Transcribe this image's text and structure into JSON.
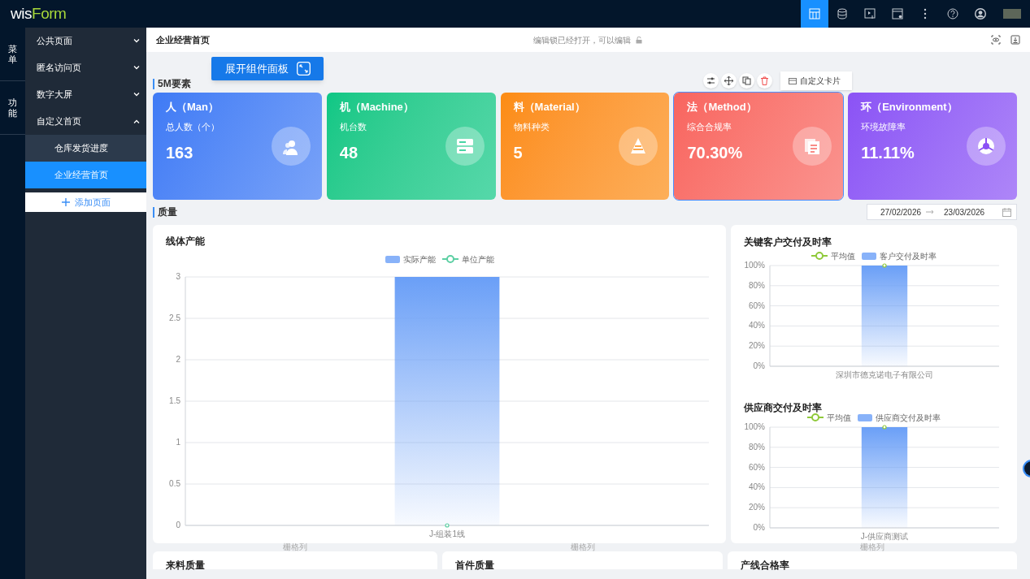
{
  "brand": {
    "part_a": "wis",
    "part_b": "Form"
  },
  "topbar_icons": [
    {
      "kind": "layout",
      "selected": true
    },
    {
      "kind": "database",
      "selected": false
    },
    {
      "kind": "screen",
      "selected": false
    },
    {
      "kind": "window",
      "selected": false
    },
    {
      "kind": "more",
      "selected": false
    },
    {
      "kind": "help",
      "selected": false
    },
    {
      "kind": "user",
      "selected": false
    }
  ],
  "rail": [
    "菜单",
    "功能"
  ],
  "nav": [
    {
      "label": "公共页面",
      "expanded": false
    },
    {
      "label": "匿名访问页",
      "expanded": false
    },
    {
      "label": "数字大屏",
      "expanded": false
    },
    {
      "label": "自定义首页",
      "expanded": true,
      "children": [
        {
          "label": "仓库发货进度",
          "selected": false
        },
        {
          "label": "企业经营首页",
          "selected": true
        }
      ]
    }
  ],
  "add_page": "添加页面",
  "header": {
    "title": "企业经营首页",
    "lock_status": "编辑锁已经打开，可以编辑"
  },
  "expand_button": "展开组件面板",
  "section_5m": "5M要素",
  "card_toolbar": {
    "label": "自定义卡片"
  },
  "cards": [
    {
      "title": "人（Man）",
      "label": "总人数（个）",
      "value": "163",
      "kind": "people",
      "color": "#3f7af5",
      "selected": false
    },
    {
      "title": "机（Machine）",
      "label": "机台数",
      "value": "48",
      "kind": "server",
      "color": "#0dc785",
      "selected": false
    },
    {
      "title": "料（Material）",
      "label": "物料种类",
      "value": "5",
      "kind": "material",
      "color": "#fc8c12",
      "selected": false
    },
    {
      "title": "法（Method）",
      "label": "综合合规率",
      "value": "70.30%",
      "kind": "document",
      "color": "#f8655f",
      "selected": true
    },
    {
      "title": "环（Environment）",
      "label": "环境故障率",
      "value": "11.11%",
      "kind": "pie",
      "color": "#8b52f5",
      "selected": false
    }
  ],
  "section_quality": "质量",
  "date_range": {
    "start": "27/02/2026",
    "end": "23/03/2026"
  },
  "charts": [
    {
      "chart_data": {
        "type": "bar",
        "grid": true,
        "title": "线体产能",
        "categories": [
          "J-组装1线"
        ],
        "ylim": [
          0,
          3
        ],
        "yticks": [
          0,
          0.5,
          1,
          1.5,
          2,
          2.5,
          3
        ],
        "series": [
          {
            "name": "实际产能",
            "type": "bar",
            "color": "#6a9ff7",
            "values": [
              3
            ]
          },
          {
            "name": "单位产能",
            "type": "line",
            "marker": true,
            "color": "#5ccfa3",
            "values": [
              0
            ]
          }
        ]
      }
    },
    {
      "chart_data": {
        "type": "bar",
        "grid": true,
        "title": "关键客户交付及时率",
        "categories": [
          "深圳市德克诺电子有限公司"
        ],
        "ylim": [
          0,
          100
        ],
        "yticks": [
          {
            "value": 0,
            "label": "0%"
          },
          {
            "value": 20,
            "label": "20%"
          },
          {
            "value": 40,
            "label": "40%"
          },
          {
            "value": 60,
            "label": "60%"
          },
          {
            "value": 80,
            "label": "80%"
          },
          {
            "value": 100,
            "label": "100%"
          }
        ],
        "series": [
          {
            "name": "平均值",
            "type": "line",
            "marker": true,
            "color": "#8fc93a",
            "values": [
              100
            ]
          },
          {
            "name": "客户交付及时率",
            "type": "bar",
            "color": "#6a9ff7",
            "values": [
              100
            ]
          }
        ]
      }
    },
    {
      "chart_data": {
        "type": "bar",
        "grid": true,
        "title": "供应商交付及时率",
        "categories": [
          "J-供应商测试"
        ],
        "ylim": [
          0,
          100
        ],
        "yticks": [
          {
            "value": 0,
            "label": "0%"
          },
          {
            "value": 20,
            "label": "20%"
          },
          {
            "value": 40,
            "label": "40%"
          },
          {
            "value": 60,
            "label": "60%"
          },
          {
            "value": 80,
            "label": "80%"
          },
          {
            "value": 100,
            "label": "100%"
          }
        ],
        "series": [
          {
            "name": "平均值",
            "type": "line",
            "marker": true,
            "color": "#8fc93a",
            "values": [
              100
            ]
          },
          {
            "name": "供应商交付及时率",
            "type": "bar",
            "color": "#6a9ff7",
            "values": [
              100
            ]
          }
        ]
      }
    }
  ],
  "grid_labels": [
    "栅格列",
    "栅格列",
    "栅格列"
  ],
  "bottom_cards": [
    "来料质量",
    "首件质量",
    "产线合格率"
  ]
}
